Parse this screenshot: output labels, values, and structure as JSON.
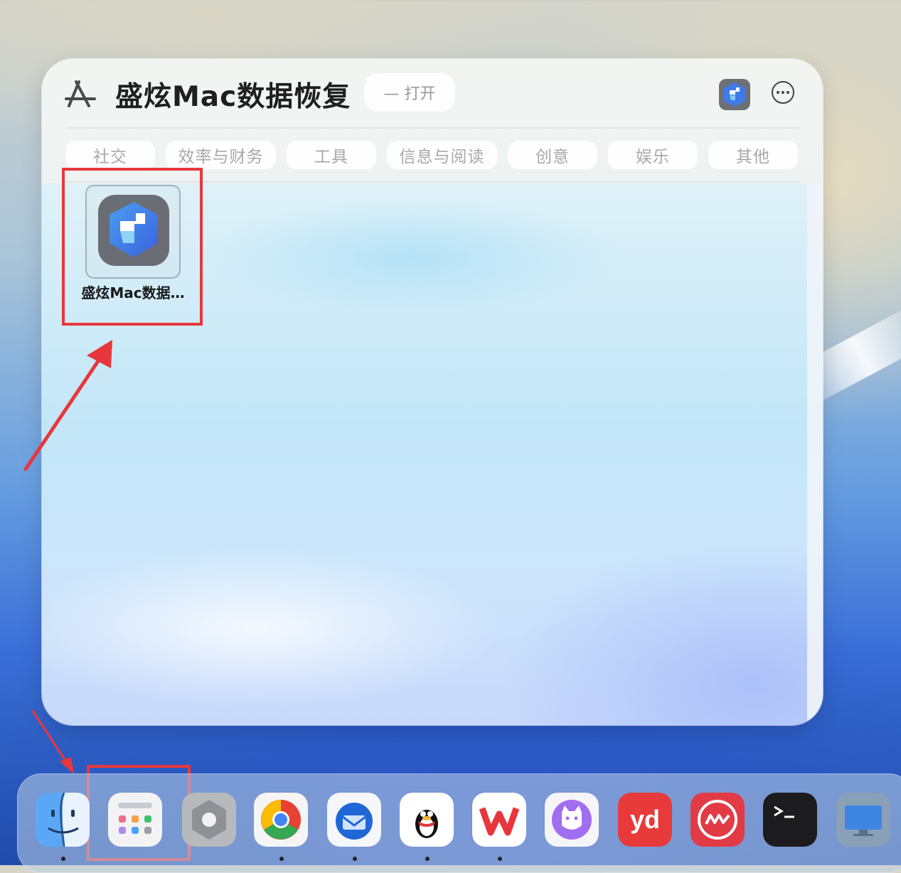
{
  "panel": {
    "title": "盛炫Mac数据恢复",
    "open_label": "— 打开",
    "tabs": [
      "社交",
      "效率与财务",
      "工具",
      "信息与阅读",
      "创意",
      "娱乐",
      "其他"
    ],
    "app_label": "盛炫Mac数据…"
  },
  "icons": {
    "app_store": "app-store-icon",
    "more": "ellipsis-circle-icon",
    "app": "data-recovery-app-icon"
  },
  "dock": {
    "items": [
      "finder-icon",
      "launchpad-icon",
      "system-app-icon",
      "chrome-icon",
      "thunderbird-icon",
      "qq-icon",
      "wps-icon",
      "cat-app-icon",
      "youdao-icon",
      "red-app-icon",
      "terminal-icon",
      "screen-icon"
    ]
  },
  "colors": {
    "highlight": "#e8373c"
  }
}
